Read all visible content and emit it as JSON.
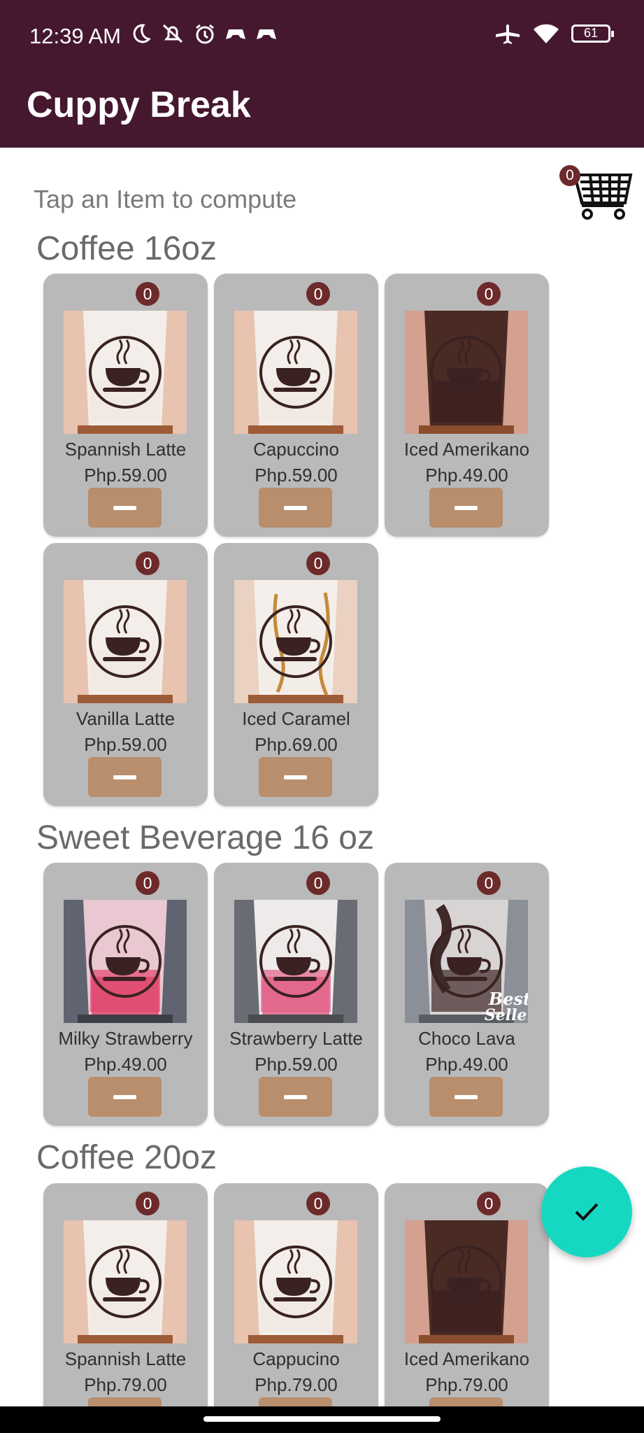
{
  "status_bar": {
    "time": "12:39 AM",
    "battery": "61",
    "icons": [
      "moon-icon",
      "bell-off-icon",
      "alarm-icon",
      "game-controller-icon",
      "game-controller-icon",
      "airplane-icon",
      "wifi-icon",
      "battery-icon"
    ]
  },
  "app": {
    "title": "Cuppy Break"
  },
  "hint": "Tap an Item to compute",
  "cart": {
    "count": "0",
    "icon": "shopping-cart-icon"
  },
  "colors": {
    "app_bar": "#451830",
    "card": "#b9b9b9",
    "badge": "#6d2a2a",
    "minus_button": "#b98e6c",
    "fab": "#16d8c2"
  },
  "sections": [
    {
      "title": "Coffee 16oz",
      "items": [
        {
          "name": "Spannish Latte",
          "price": "Php.59.00",
          "count": "0",
          "image": "latte"
        },
        {
          "name": "Capuccino",
          "price": "Php.59.00",
          "count": "0",
          "image": "latte"
        },
        {
          "name": "Iced Amerikano",
          "price": "Php.49.00",
          "count": "0",
          "image": "dark"
        },
        {
          "name": "Vanilla Latte",
          "price": "Php.59.00",
          "count": "0",
          "image": "latte"
        },
        {
          "name": "Iced Caramel",
          "price": "Php.69.00",
          "count": "0",
          "image": "caramel"
        }
      ]
    },
    {
      "title": "Sweet Beverage 16 oz",
      "items": [
        {
          "name": "Milky Strawberry",
          "price": "Php.49.00",
          "count": "0",
          "image": "strawberry"
        },
        {
          "name": "Strawberry Latte",
          "price": "Php.59.00",
          "count": "0",
          "image": "strawberry-latte"
        },
        {
          "name": "Choco Lava",
          "price": "Php.49.00",
          "count": "0",
          "image": "choco"
        }
      ]
    },
    {
      "title": "Coffee 20oz",
      "items": [
        {
          "name": "Spannish Latte",
          "price": "Php.79.00",
          "count": "0",
          "image": "latte"
        },
        {
          "name": "Cappucino",
          "price": "Php.79.00",
          "count": "0",
          "image": "latte"
        },
        {
          "name": "Iced Amerikano",
          "price": "Php.79.00",
          "count": "0",
          "image": "dark"
        }
      ]
    }
  ],
  "choco_overlay": "Best Seller",
  "fab": {
    "icon": "check-icon"
  }
}
